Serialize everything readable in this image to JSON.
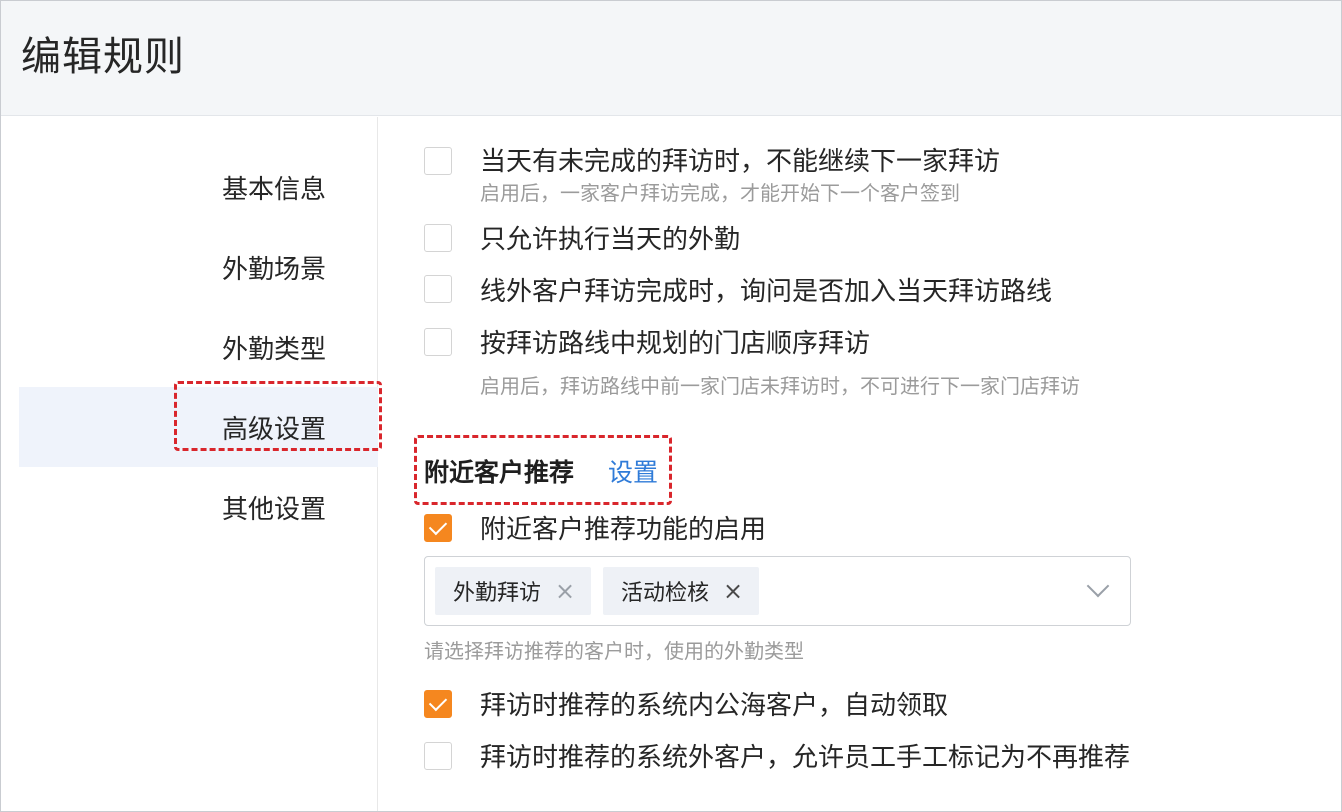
{
  "header": {
    "title": "编辑规则"
  },
  "sidebar": {
    "items": [
      {
        "label": "基本信息"
      },
      {
        "label": "外勤场景"
      },
      {
        "label": "外勤类型"
      },
      {
        "label": "高级设置"
      },
      {
        "label": "其他设置"
      }
    ]
  },
  "content": {
    "opt_cutoff": {
      "label": "当天有未完成的拜访时，不能继续下一家拜访",
      "hint": "启用后，一家客户拜访完成，才能开始下一个客户签到"
    },
    "opt_today_only": {
      "label": "只允许执行当天的外勤"
    },
    "opt_ask_add_route": {
      "label": "线外客户拜访完成时，询问是否加入当天拜访路线"
    },
    "opt_route_order": {
      "label": "按拜访路线中规划的门店顺序拜访",
      "hint": "启用后，拜访路线中前一家门店未拜访时，不可进行下一家门店拜访"
    },
    "nearby": {
      "title": "附近客户推荐",
      "link": "设置",
      "enable_label": "附近客户推荐功能的启用",
      "tags": [
        "外勤拜访",
        "活动检核"
      ],
      "tag_close": "×",
      "select_hint": "请选择拜访推荐的客户时，使用的外勤类型",
      "opt_auto_claim": {
        "label": "拜访时推荐的系统内公海客户，自动领取"
      },
      "opt_mark_no_recommend": {
        "label": "拜访时推荐的系统外客户，允许员工手工标记为不再推荐"
      }
    }
  },
  "colors": {
    "accent": "#f5871f",
    "link": "#2f7bd8",
    "highlight": "#d9262c",
    "active_bg": "#eff3fb"
  }
}
